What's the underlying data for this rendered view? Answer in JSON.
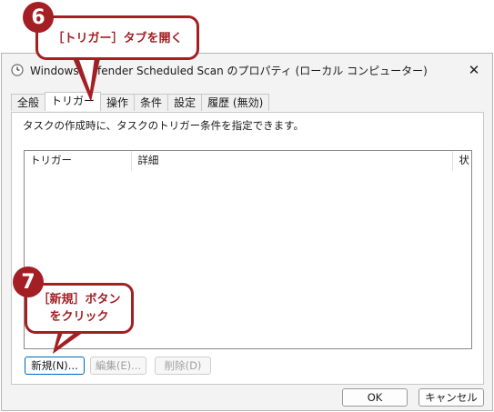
{
  "window": {
    "title": "Windows Defender Scheduled Scan のプロパティ (ローカル コンピューター)",
    "close_glyph": "✕"
  },
  "tabs": [
    {
      "label": "全般"
    },
    {
      "label": "トリガー"
    },
    {
      "label": "操作"
    },
    {
      "label": "条件"
    },
    {
      "label": "設定"
    },
    {
      "label": "履歴 (無効)"
    }
  ],
  "panel": {
    "instruction": "タスクの作成時に、タスクのトリガー条件を指定できます。"
  },
  "list": {
    "columns": [
      "トリガー",
      "詳細",
      "状"
    ]
  },
  "buttons": {
    "new": "新規(N)...",
    "edit": "編集(E)...",
    "delete": "削除(D)",
    "ok": "OK",
    "cancel": "キャンセル"
  },
  "callouts": {
    "step6_number": "6",
    "step6_text": "［トリガー］タブを開く",
    "step7_number": "7",
    "step7_line1": "［新規］ボタン",
    "step7_line2": "をクリック"
  },
  "colors": {
    "callout": "#a31f24",
    "default_button_border": "#0067c0"
  }
}
